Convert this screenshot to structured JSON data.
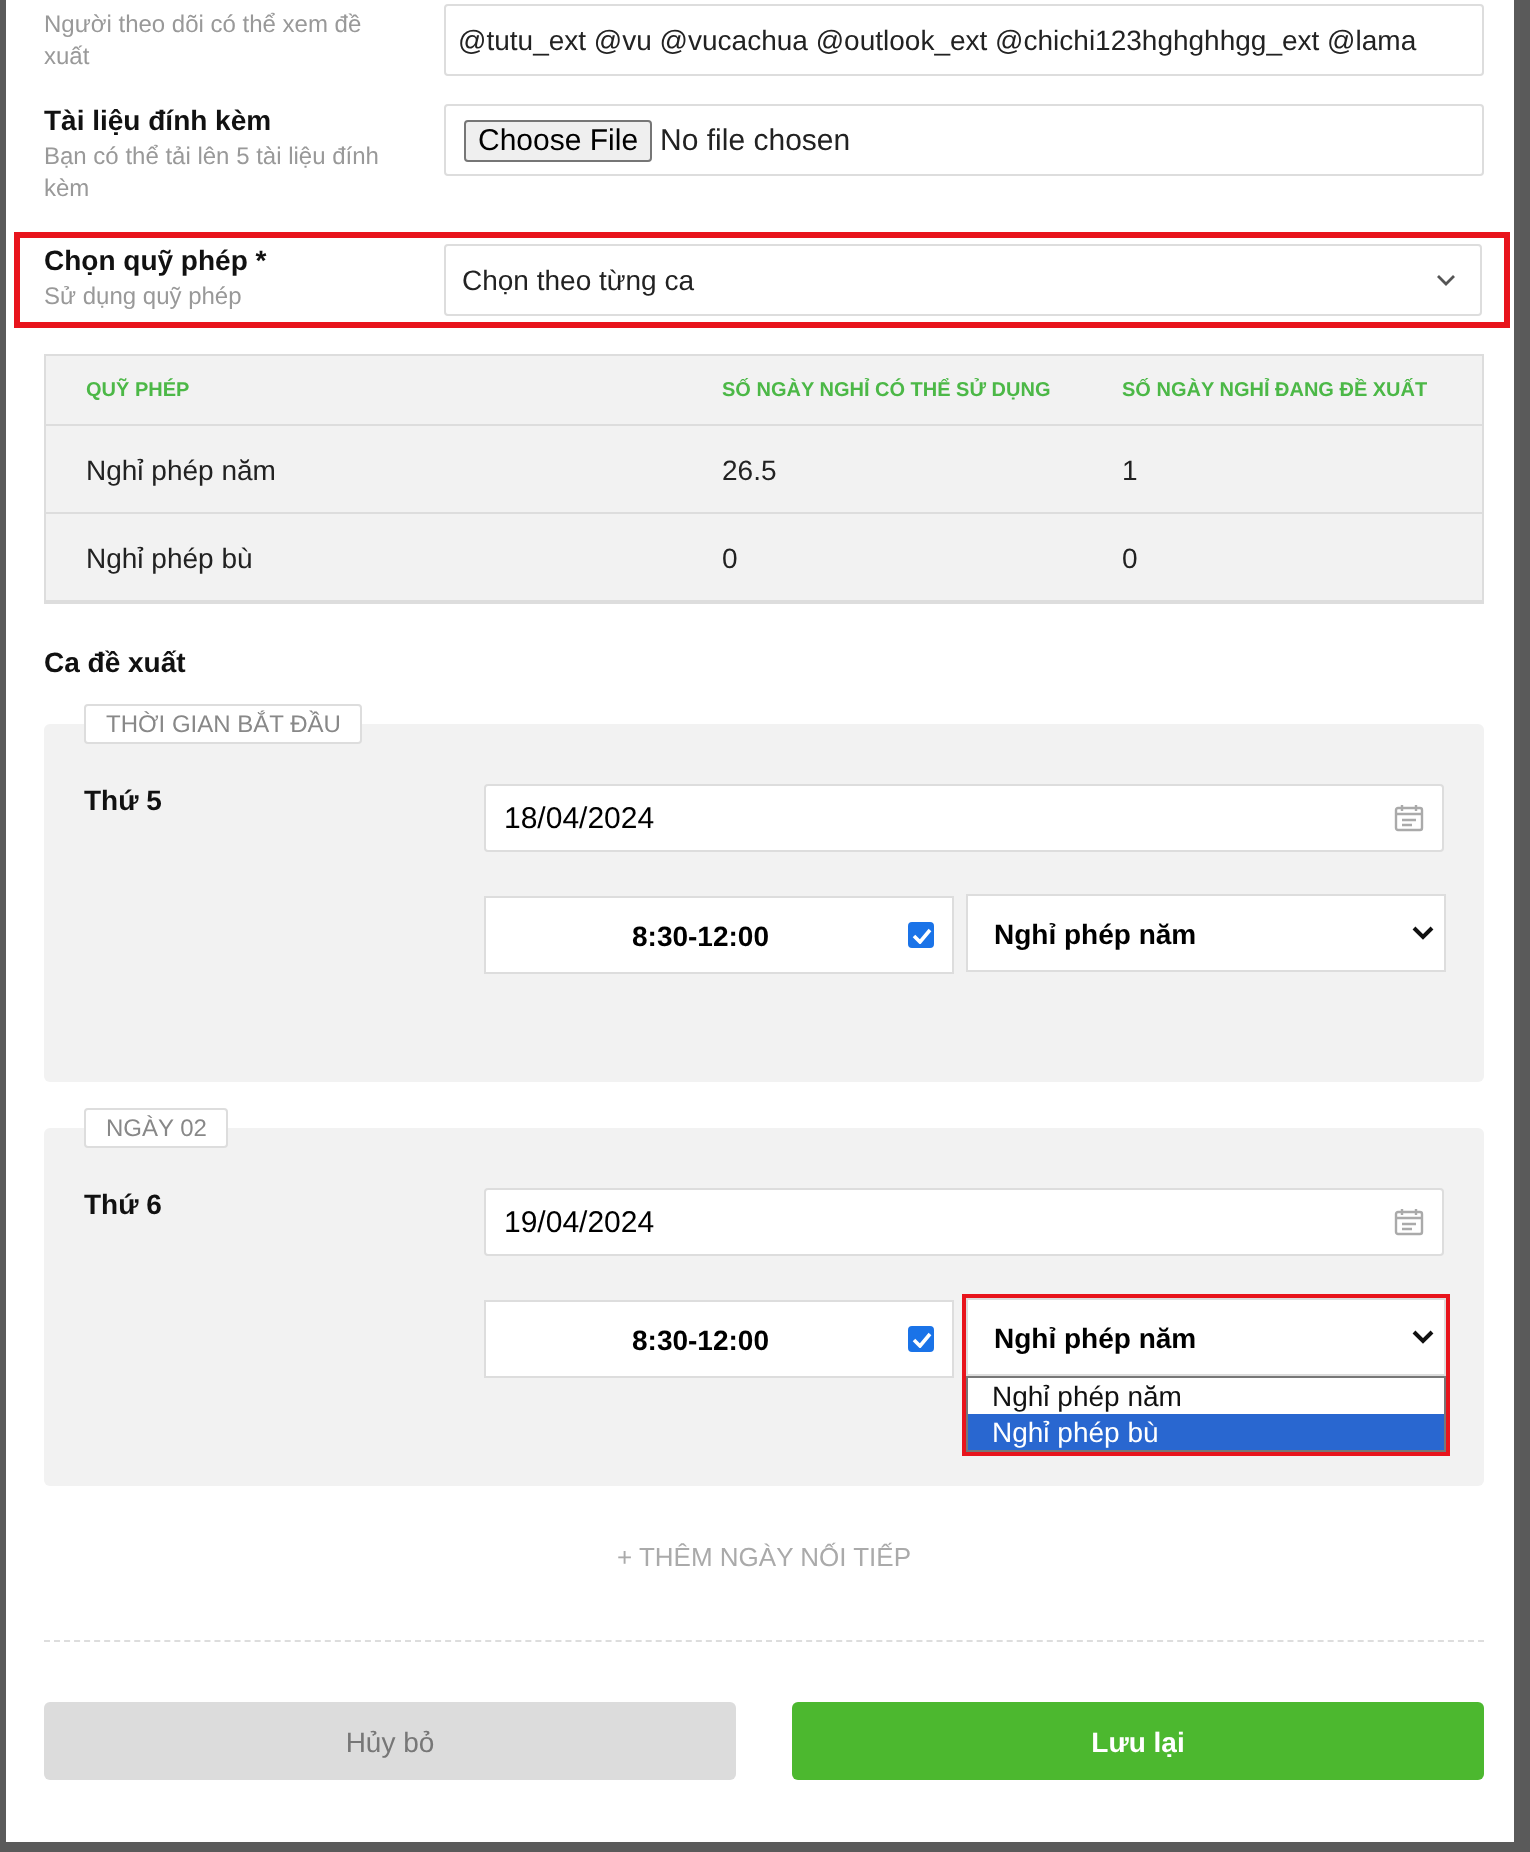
{
  "followers": {
    "hint": "Người theo dõi có thể xem đề xuất",
    "value": "@tutu_ext @vu @vucachua @outlook_ext @chichi123hghghhgg_ext @lama"
  },
  "attachment": {
    "label": "Tài liệu đính kèm",
    "hint": "Bạn có thể tải lên 5 tài liệu đính kèm",
    "button": "Choose File",
    "status": "No file chosen"
  },
  "quota_select": {
    "label": "Chọn quỹ phép *",
    "hint": "Sử dụng quỹ phép",
    "value": "Chọn theo từng ca",
    "highlighted": true
  },
  "table": {
    "columns": [
      "QUỸ PHÉP",
      "SỐ NGÀY NGHỈ CÓ THỂ SỬ DỤNG",
      "SỐ NGÀY NGHỈ ĐANG ĐỀ XUẤT"
    ],
    "rows": [
      [
        "Nghỉ phép năm",
        "26.5",
        "1"
      ],
      [
        "Nghỉ phép bù",
        "0",
        "0"
      ]
    ]
  },
  "shifts_title": "Ca đề xuất",
  "days": [
    {
      "tag": "THỜI GIAN BẮT ĐẦU",
      "weekday": "Thứ 5",
      "date": "18/04/2024",
      "time": "8:30-12:00",
      "checked": true,
      "leave_type": "Nghỉ phép năm",
      "highlighted": false,
      "expanded": false
    },
    {
      "tag": "NGÀY 02",
      "weekday": "Thứ 6",
      "date": "19/04/2024",
      "time": "8:30-12:00",
      "checked": true,
      "leave_type": "Nghỉ phép năm",
      "highlighted": true,
      "expanded": true,
      "options": [
        {
          "label": "Nghỉ phép năm",
          "selected": false
        },
        {
          "label": "Nghỉ phép bù",
          "selected": true
        }
      ]
    }
  ],
  "add_day": "+ THÊM NGÀY NỐI TIẾP",
  "buttons": {
    "cancel": "Hủy bỏ",
    "save": "Lưu lại"
  }
}
